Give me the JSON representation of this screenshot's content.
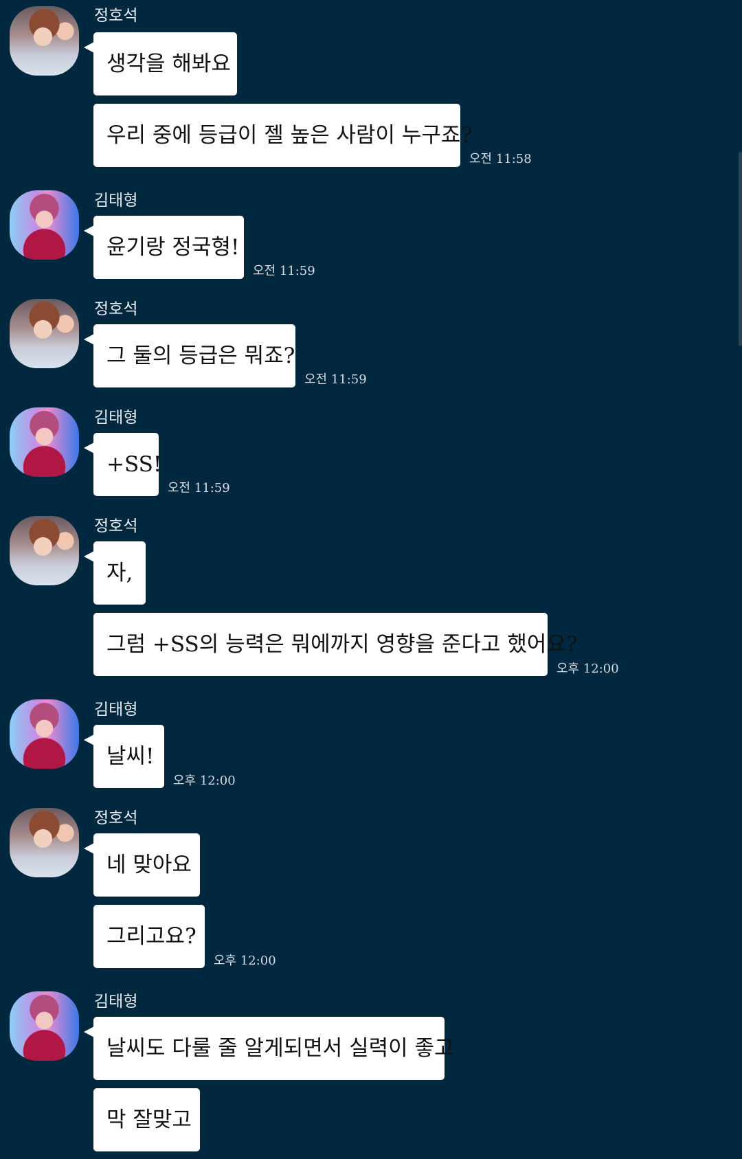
{
  "messages": [
    {
      "sender": "정호석",
      "avatar_icon": "avatar-hoseok",
      "texts": [
        "생각을 해봐요",
        "우리 중에 등급이 젤 높은 사람이 누구죠?"
      ],
      "time": "오전 11:58"
    },
    {
      "sender": "김태형",
      "avatar_icon": "avatar-taehyung",
      "texts": [
        "윤기랑 정국형!"
      ],
      "time": "오전 11:59"
    },
    {
      "sender": "정호석",
      "avatar_icon": "avatar-hoseok",
      "texts": [
        "그 둘의 등급은 뭐죠?"
      ],
      "time": "오전 11:59"
    },
    {
      "sender": "김태형",
      "avatar_icon": "avatar-taehyung",
      "texts": [
        "+SS!"
      ],
      "time": "오전 11:59"
    },
    {
      "sender": "정호석",
      "avatar_icon": "avatar-hoseok",
      "texts": [
        "자,",
        "그럼 +SS의 능력은 뭐에까지 영향을 준다고 했어요?"
      ],
      "time": "오후 12:00"
    },
    {
      "sender": "김태형",
      "avatar_icon": "avatar-taehyung",
      "texts": [
        "날씨!"
      ],
      "time": "오후 12:00"
    },
    {
      "sender": "정호석",
      "avatar_icon": "avatar-hoseok",
      "texts": [
        "네 맞아요",
        "그리고요?"
      ],
      "time": "오후 12:00"
    },
    {
      "sender": "김태형",
      "avatar_icon": "avatar-taehyung",
      "texts": [
        "날씨도 다룰 줄 알게되면서 실력이 좋고",
        "막 잘맞고"
      ],
      "time": ""
    }
  ],
  "colors": {
    "background": "#022840",
    "bubble": "#ffffff",
    "text": "#111111",
    "meta_text": "#d8dde4"
  }
}
